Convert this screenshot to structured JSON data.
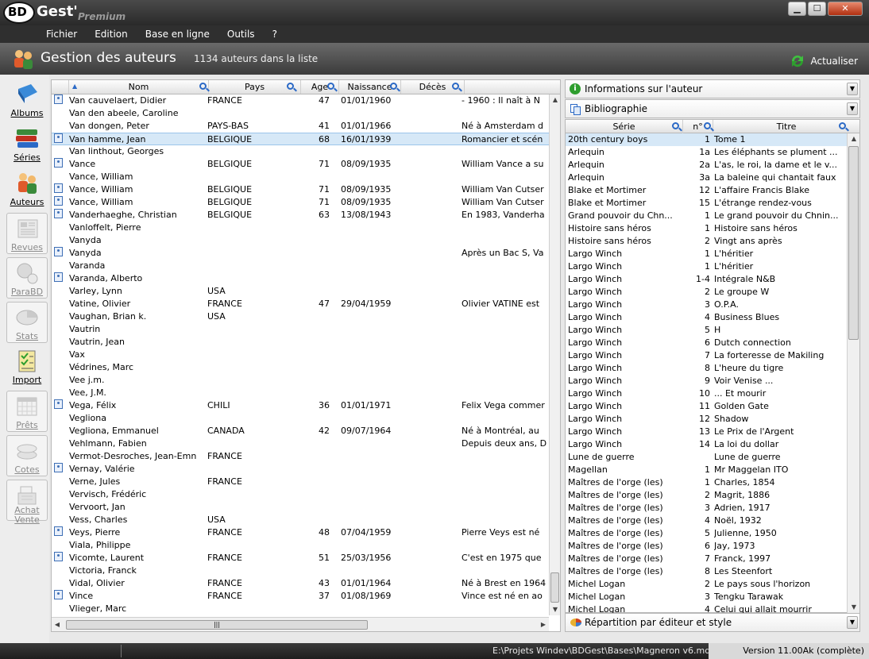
{
  "app": {
    "logo_bd": "BD",
    "logo_gest": "Gest'",
    "logo_edition": "Premium"
  },
  "window_buttons": {
    "minimize": "▁",
    "maximize": "☐",
    "close": "✕"
  },
  "menu": [
    "Fichier",
    "Edition",
    "Base en ligne",
    "Outils",
    "?"
  ],
  "header": {
    "title": "Gestion des auteurs",
    "count": "1134 auteurs dans la liste",
    "refresh": "Actualiser"
  },
  "sidebar": [
    {
      "label": "Albums",
      "enabled": true,
      "icon": "book-icon"
    },
    {
      "label": "Séries",
      "enabled": true,
      "icon": "books-stack-icon"
    },
    {
      "label": "Auteurs",
      "enabled": true,
      "icon": "authors-icon"
    },
    {
      "label": "Revues",
      "enabled": false,
      "icon": "newspaper-icon"
    },
    {
      "label": "ParaBD",
      "enabled": false,
      "icon": "parabd-icon"
    },
    {
      "label": "Stats",
      "enabled": false,
      "icon": "pie-chart-icon"
    },
    {
      "label": "Import",
      "enabled": true,
      "icon": "checklist-icon"
    },
    {
      "label": "Prêts",
      "enabled": false,
      "icon": "calendar-icon"
    },
    {
      "label": "Cotes",
      "enabled": false,
      "icon": "coins-icon"
    },
    {
      "label": "Achat Vente",
      "enabled": false,
      "icon": "cash-register-icon"
    }
  ],
  "authors_table": {
    "columns": [
      "Nom",
      "Pays",
      "Age",
      "Naissance",
      "Décès"
    ],
    "rows": [
      {
        "photo": true,
        "nom": "Van cauvelaert, Didier",
        "pays": "FRANCE",
        "age": "47",
        "naissance": "01/01/1960",
        "bio": "- 1960 : Il naît à N"
      },
      {
        "photo": false,
        "nom": "Van den abeele, Caroline",
        "pays": "",
        "age": "",
        "naissance": "",
        "bio": ""
      },
      {
        "photo": false,
        "nom": "Van dongen, Peter",
        "pays": "PAYS-BAS",
        "age": "41",
        "naissance": "01/01/1966",
        "bio": "Né à Amsterdam d"
      },
      {
        "photo": true,
        "nom": "Van hamme, Jean",
        "pays": "BELGIQUE",
        "age": "68",
        "naissance": "16/01/1939",
        "bio": "Romancier et scén",
        "selected": true
      },
      {
        "photo": false,
        "nom": "Van linthout, Georges",
        "pays": "",
        "age": "",
        "naissance": "",
        "bio": ""
      },
      {
        "photo": true,
        "nom": "Vance",
        "pays": "BELGIQUE",
        "age": "71",
        "naissance": "08/09/1935",
        "bio": "William Vance a su"
      },
      {
        "photo": false,
        "nom": "Vance, William",
        "pays": "",
        "age": "",
        "naissance": "",
        "bio": ""
      },
      {
        "photo": true,
        "nom": "Vance, William",
        "pays": "BELGIQUE",
        "age": "71",
        "naissance": "08/09/1935",
        "bio": "William Van Cutser"
      },
      {
        "photo": true,
        "nom": "Vance, William",
        "pays": "BELGIQUE",
        "age": "71",
        "naissance": "08/09/1935",
        "bio": "William Van Cutser"
      },
      {
        "photo": true,
        "nom": "Vanderhaeghe, Christian",
        "pays": "BELGIQUE",
        "age": "63",
        "naissance": "13/08/1943",
        "bio": "En 1983, Vanderha"
      },
      {
        "photo": false,
        "nom": "Vanloffelt, Pierre",
        "pays": "",
        "age": "",
        "naissance": "",
        "bio": ""
      },
      {
        "photo": false,
        "nom": "Vanyda",
        "pays": "",
        "age": "",
        "naissance": "",
        "bio": ""
      },
      {
        "photo": true,
        "nom": "Vanyda",
        "pays": "",
        "age": "",
        "naissance": "",
        "bio": "Après un Bac S, Va"
      },
      {
        "photo": false,
        "nom": "Varanda",
        "pays": "",
        "age": "",
        "naissance": "",
        "bio": ""
      },
      {
        "photo": true,
        "nom": "Varanda, Alberto",
        "pays": "",
        "age": "",
        "naissance": "",
        "bio": ""
      },
      {
        "photo": false,
        "nom": "Varley, Lynn",
        "pays": "USA",
        "age": "",
        "naissance": "",
        "bio": ""
      },
      {
        "photo": false,
        "nom": "Vatine, Olivier",
        "pays": "FRANCE",
        "age": "47",
        "naissance": "29/04/1959",
        "bio": "Olivier VATINE est"
      },
      {
        "photo": false,
        "nom": "Vaughan, Brian k.",
        "pays": "USA",
        "age": "",
        "naissance": "",
        "bio": ""
      },
      {
        "photo": false,
        "nom": "Vautrin",
        "pays": "",
        "age": "",
        "naissance": "",
        "bio": ""
      },
      {
        "photo": false,
        "nom": "Vautrin, Jean",
        "pays": "",
        "age": "",
        "naissance": "",
        "bio": ""
      },
      {
        "photo": false,
        "nom": "Vax",
        "pays": "",
        "age": "",
        "naissance": "",
        "bio": ""
      },
      {
        "photo": false,
        "nom": "Védrines, Marc",
        "pays": "",
        "age": "",
        "naissance": "",
        "bio": ""
      },
      {
        "photo": false,
        "nom": "Vee j.m.",
        "pays": "",
        "age": "",
        "naissance": "",
        "bio": ""
      },
      {
        "photo": false,
        "nom": "Vee, J.M.",
        "pays": "",
        "age": "",
        "naissance": "",
        "bio": ""
      },
      {
        "photo": true,
        "nom": "Vega, Félix",
        "pays": "CHILI",
        "age": "36",
        "naissance": "01/01/1971",
        "bio": "Felix Vega commer"
      },
      {
        "photo": false,
        "nom": "Vegliona",
        "pays": "",
        "age": "",
        "naissance": "",
        "bio": ""
      },
      {
        "photo": false,
        "nom": "Vegliona, Emmanuel",
        "pays": "CANADA",
        "age": "42",
        "naissance": "09/07/1964",
        "bio": "Né à Montréal, au"
      },
      {
        "photo": false,
        "nom": "Vehlmann, Fabien",
        "pays": "",
        "age": "",
        "naissance": "",
        "bio": "Depuis deux ans, D"
      },
      {
        "photo": false,
        "nom": "Vermot-Desroches, Jean-Emn",
        "pays": "FRANCE",
        "age": "",
        "naissance": "",
        "bio": ""
      },
      {
        "photo": true,
        "nom": "Vernay, Valérie",
        "pays": "",
        "age": "",
        "naissance": "",
        "bio": ""
      },
      {
        "photo": false,
        "nom": "Verne, Jules",
        "pays": "FRANCE",
        "age": "",
        "naissance": "",
        "bio": ""
      },
      {
        "photo": false,
        "nom": "Vervisch, Frédéric",
        "pays": "",
        "age": "",
        "naissance": "",
        "bio": ""
      },
      {
        "photo": false,
        "nom": "Vervoort, Jan",
        "pays": "",
        "age": "",
        "naissance": "",
        "bio": ""
      },
      {
        "photo": false,
        "nom": "Vess, Charles",
        "pays": "USA",
        "age": "",
        "naissance": "",
        "bio": ""
      },
      {
        "photo": true,
        "nom": "Veys, Pierre",
        "pays": "FRANCE",
        "age": "48",
        "naissance": "07/04/1959",
        "bio": "Pierre Veys est né"
      },
      {
        "photo": false,
        "nom": "Viala, Philippe",
        "pays": "",
        "age": "",
        "naissance": "",
        "bio": ""
      },
      {
        "photo": true,
        "nom": "Vicomte, Laurent",
        "pays": "FRANCE",
        "age": "51",
        "naissance": "25/03/1956",
        "bio": "C'est en 1975 que"
      },
      {
        "photo": false,
        "nom": "Victoria, Franck",
        "pays": "",
        "age": "",
        "naissance": "",
        "bio": ""
      },
      {
        "photo": false,
        "nom": "Vidal, Olivier",
        "pays": "FRANCE",
        "age": "43",
        "naissance": "01/01/1964",
        "bio": "Né à Brest en 1964"
      },
      {
        "photo": true,
        "nom": "Vince",
        "pays": "FRANCE",
        "age": "37",
        "naissance": "01/08/1969",
        "bio": "Vince est né en ao"
      },
      {
        "photo": false,
        "nom": "Vlieger, Marc",
        "pays": "",
        "age": "",
        "naissance": "",
        "bio": ""
      }
    ]
  },
  "right_panel": {
    "info_combo": "Informations sur l'auteur",
    "biblio_combo": "Bibliographie",
    "columns": [
      "Série",
      "n°",
      "Titre"
    ],
    "rows": [
      {
        "serie": "20th century boys",
        "num": "1",
        "titre": "Tome 1",
        "selected": true
      },
      {
        "serie": "Arlequin",
        "num": "1a",
        "titre": "Les éléphants se plument ..."
      },
      {
        "serie": "Arlequin",
        "num": "2a",
        "titre": "L'as, le roi, la dame et le v..."
      },
      {
        "serie": "Arlequin",
        "num": "3a",
        "titre": "La baleine qui chantait faux"
      },
      {
        "serie": "Blake et Mortimer",
        "num": "12",
        "titre": "L'affaire Francis Blake"
      },
      {
        "serie": "Blake et Mortimer",
        "num": "15",
        "titre": "L'étrange rendez-vous"
      },
      {
        "serie": "Grand pouvoir du Chn...",
        "num": "1",
        "titre": "Le grand pouvoir du Chnin..."
      },
      {
        "serie": "Histoire sans héros",
        "num": "1",
        "titre": "Histoire sans héros"
      },
      {
        "serie": "Histoire sans héros",
        "num": "2",
        "titre": "Vingt ans après"
      },
      {
        "serie": "Largo Winch",
        "num": "1",
        "titre": "L'héritier"
      },
      {
        "serie": "Largo Winch",
        "num": "1",
        "titre": "L'héritier"
      },
      {
        "serie": "Largo Winch",
        "num": "1-4",
        "titre": "Intégrale N&B"
      },
      {
        "serie": "Largo Winch",
        "num": "2",
        "titre": "Le groupe W"
      },
      {
        "serie": "Largo Winch",
        "num": "3",
        "titre": "O.P.A."
      },
      {
        "serie": "Largo Winch",
        "num": "4",
        "titre": "Business Blues"
      },
      {
        "serie": "Largo Winch",
        "num": "5",
        "titre": "H"
      },
      {
        "serie": "Largo Winch",
        "num": "6",
        "titre": "Dutch connection"
      },
      {
        "serie": "Largo Winch",
        "num": "7",
        "titre": "La forteresse de Makiling"
      },
      {
        "serie": "Largo Winch",
        "num": "8",
        "titre": "L'heure du tigre"
      },
      {
        "serie": "Largo Winch",
        "num": "9",
        "titre": "Voir Venise ..."
      },
      {
        "serie": "Largo Winch",
        "num": "10",
        "titre": "... Et mourir"
      },
      {
        "serie": "Largo Winch",
        "num": "11",
        "titre": "Golden Gate"
      },
      {
        "serie": "Largo Winch",
        "num": "12",
        "titre": "Shadow"
      },
      {
        "serie": "Largo Winch",
        "num": "13",
        "titre": "Le Prix de l'Argent"
      },
      {
        "serie": "Largo Winch",
        "num": "14",
        "titre": "La loi du dollar"
      },
      {
        "serie": "Lune de guerre",
        "num": "",
        "titre": "Lune de guerre"
      },
      {
        "serie": "Magellan",
        "num": "1",
        "titre": "Mr Maggelan ITO"
      },
      {
        "serie": "Maîtres de l'orge (les)",
        "num": "1",
        "titre": "Charles, 1854"
      },
      {
        "serie": "Maîtres de l'orge (les)",
        "num": "2",
        "titre": "Magrit, 1886"
      },
      {
        "serie": "Maîtres de l'orge (les)",
        "num": "3",
        "titre": "Adrien, 1917"
      },
      {
        "serie": "Maîtres de l'orge (les)",
        "num": "4",
        "titre": "Noël, 1932"
      },
      {
        "serie": "Maîtres de l'orge (les)",
        "num": "5",
        "titre": "Julienne, 1950"
      },
      {
        "serie": "Maîtres de l'orge (les)",
        "num": "6",
        "titre": "Jay, 1973"
      },
      {
        "serie": "Maîtres de l'orge (les)",
        "num": "7",
        "titre": "Franck, 1997"
      },
      {
        "serie": "Maîtres de l'orge (les)",
        "num": "8",
        "titre": "Les Steenfort"
      },
      {
        "serie": "Michel Logan",
        "num": "2",
        "titre": "Le pays sous l'horizon"
      },
      {
        "serie": "Michel Logan",
        "num": "3",
        "titre": "Tengku Tarawak"
      },
      {
        "serie": "Michel Logan",
        "num": "4",
        "titre": "Celui qui allait mourrir"
      }
    ],
    "repartition": "Répartition par éditeur et style"
  },
  "statusbar": {
    "path": "E:\\Projets Windev\\BDGest\\Bases\\Magneron v6.mdb",
    "version": "Version 11.00Ak (complète)"
  },
  "colors": {
    "selection": "#d6e8f7",
    "header_dark": "#3b3b3b",
    "accent_blue": "#2b69c6"
  }
}
